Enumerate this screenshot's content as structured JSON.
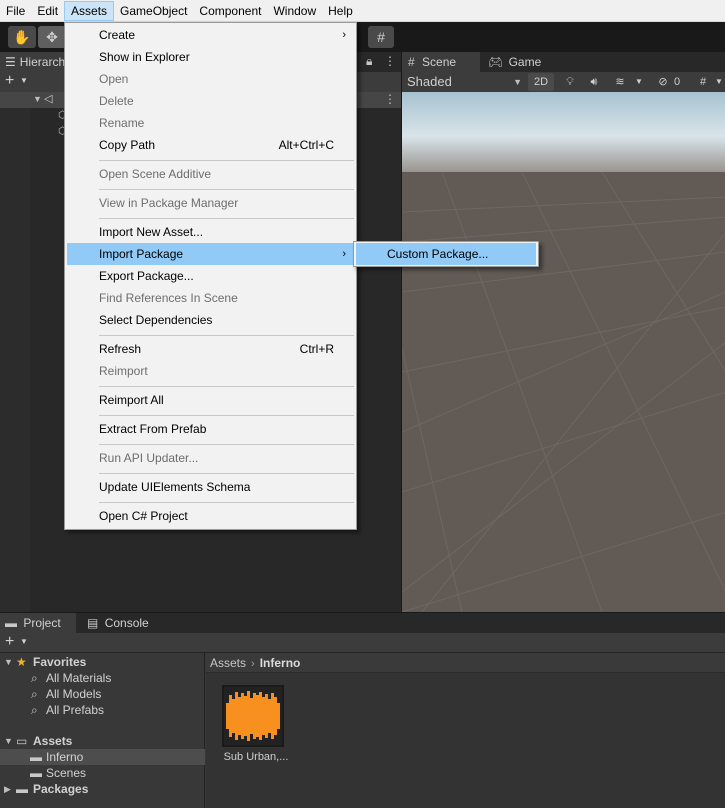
{
  "menubar": {
    "items": [
      "File",
      "Edit",
      "Assets",
      "GameObject",
      "Component",
      "Window",
      "Help"
    ]
  },
  "hierarchy": {
    "tab_label": "Hierarch"
  },
  "scene": {
    "tabs": [
      "Scene",
      "Game"
    ],
    "shading_mode": "Shaded",
    "mode_2d": "2D",
    "hidden_count": "0"
  },
  "assets_menu": {
    "items": [
      {
        "label": "Create",
        "enabled": true,
        "submenu": true
      },
      {
        "label": "Show in Explorer",
        "enabled": true
      },
      {
        "label": "Open",
        "enabled": false
      },
      {
        "label": "Delete",
        "enabled": false
      },
      {
        "label": "Rename",
        "enabled": false
      },
      {
        "label": "Copy Path",
        "enabled": true,
        "shortcut": "Alt+Ctrl+C"
      },
      {
        "label": "Open Scene Additive",
        "enabled": false
      },
      {
        "label": "View in Package Manager",
        "enabled": false
      },
      {
        "label": "Import New Asset...",
        "enabled": true
      },
      {
        "label": "Import Package",
        "enabled": true,
        "submenu": true,
        "highlighted": true
      },
      {
        "label": "Export Package...",
        "enabled": true
      },
      {
        "label": "Find References In Scene",
        "enabled": false
      },
      {
        "label": "Select Dependencies",
        "enabled": true
      },
      {
        "label": "Refresh",
        "enabled": true,
        "shortcut": "Ctrl+R"
      },
      {
        "label": "Reimport",
        "enabled": false
      },
      {
        "label": "Reimport All",
        "enabled": true
      },
      {
        "label": "Extract From Prefab",
        "enabled": true
      },
      {
        "label": "Run API Updater...",
        "enabled": false
      },
      {
        "label": "Update UIElements Schema",
        "enabled": true
      },
      {
        "label": "Open C# Project",
        "enabled": true
      }
    ]
  },
  "import_submenu": {
    "items": [
      "Custom Package..."
    ]
  },
  "project": {
    "tabs": [
      "Project",
      "Console"
    ],
    "tree": {
      "favorites": "Favorites",
      "favorite_items": [
        "All Materials",
        "All Models",
        "All Prefabs"
      ],
      "assets": "Assets",
      "asset_folders": [
        "Inferno",
        "Scenes"
      ],
      "packages": "Packages"
    },
    "breadcrumb": {
      "root": "Assets",
      "current": "Inferno"
    },
    "asset": {
      "label": "Sub Urban,..."
    }
  },
  "colors": {
    "menu_highlight": "#91c9f7",
    "audio_waveform": "#f7901e",
    "favorites_star": "#f0b429"
  }
}
